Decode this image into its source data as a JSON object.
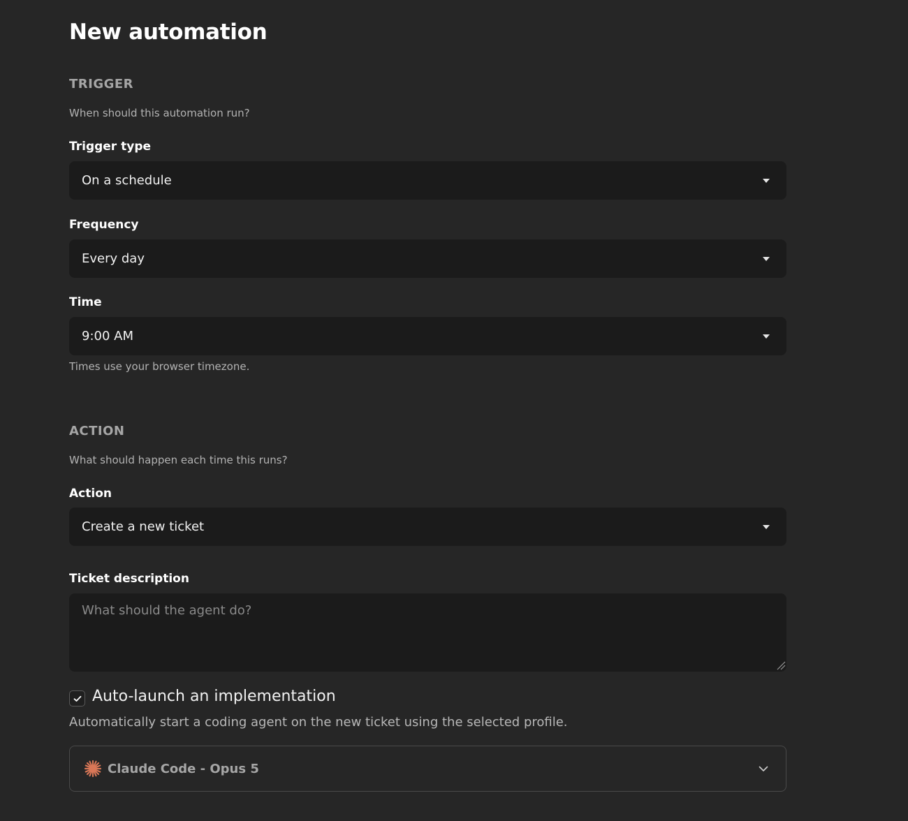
{
  "page": {
    "title": "New automation"
  },
  "trigger": {
    "heading": "TRIGGER",
    "subtitle": "When should this automation run?",
    "trigger_type": {
      "label": "Trigger type",
      "value": "On a schedule"
    },
    "frequency": {
      "label": "Frequency",
      "value": "Every day"
    },
    "time": {
      "label": "Time",
      "value": "9:00 AM"
    },
    "timezone_hint": "Times use your browser timezone."
  },
  "action": {
    "heading": "ACTION",
    "subtitle": "What should happen each time this runs?",
    "action_select": {
      "label": "Action",
      "value": "Create a new ticket"
    },
    "ticket_description": {
      "label": "Ticket description",
      "placeholder": "What should the agent do?",
      "value": ""
    },
    "auto_launch": {
      "checked": true,
      "label": "Auto-launch an implementation",
      "description": "Automatically start a coding agent on the new ticket using the selected profile."
    },
    "profile": {
      "value": "Claude Code - Opus 5",
      "icon": "claude-sparkle-icon"
    }
  },
  "colors": {
    "background": "#262626",
    "input_background": "#1b1b1b",
    "accent_icon": "#d97757"
  }
}
